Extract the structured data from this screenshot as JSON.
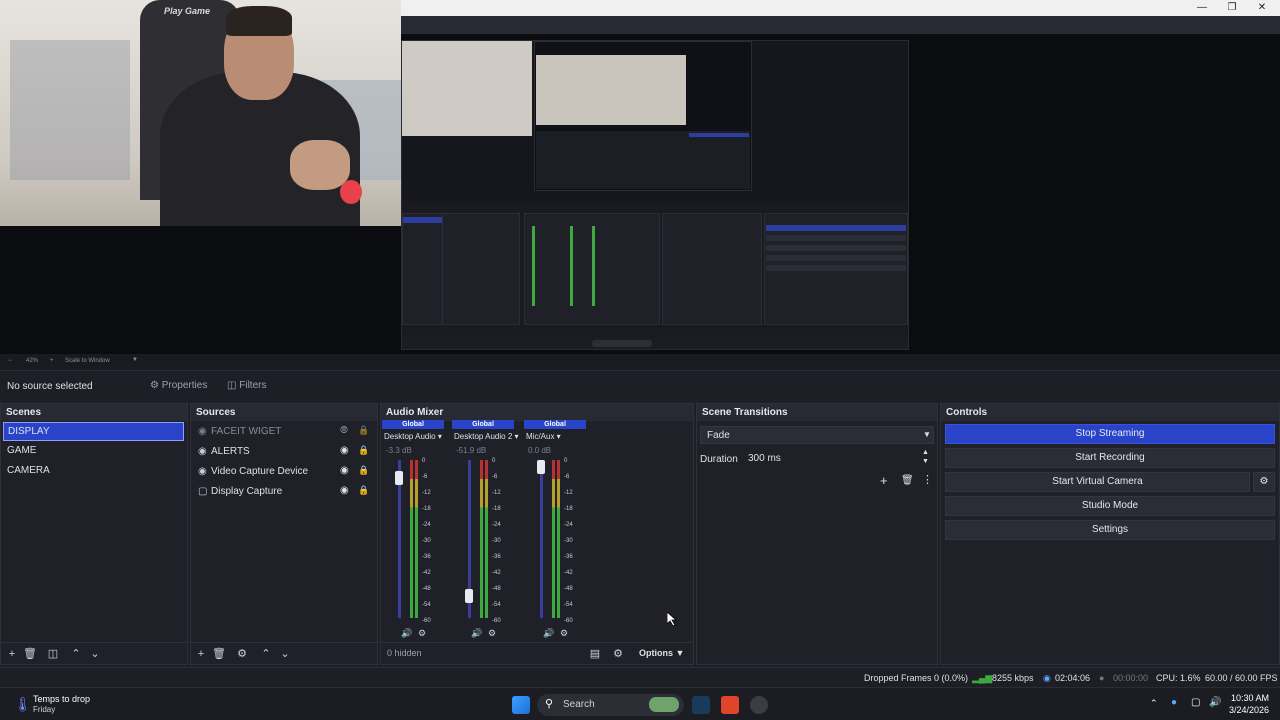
{
  "preview": {
    "webcam_logo": "Play Game",
    "zoom_minus": "−",
    "zoom_level": "42%",
    "zoom_plus": "+",
    "scale_mode": "Scale to Window"
  },
  "source_toolbar": {
    "no_source": "No source selected",
    "properties_label": "Properties",
    "filters_label": "Filters"
  },
  "scenes": {
    "title": "Scenes",
    "items": [
      "DISPLAY",
      "GAME",
      "CAMERA"
    ]
  },
  "sources": {
    "title": "Sources",
    "items": [
      {
        "label": "FACEIT WIGET",
        "icon": "browser-icon",
        "visible": false
      },
      {
        "label": "ALERTS",
        "icon": "browser-icon",
        "visible": true
      },
      {
        "label": "Video Capture Device",
        "icon": "camera-icon",
        "visible": true
      },
      {
        "label": "Display Capture",
        "icon": "monitor-icon",
        "visible": true
      }
    ]
  },
  "audio_mixer": {
    "title": "Audio Mixer",
    "hidden_label": "0 hidden",
    "options_label": "Options",
    "ticks": [
      "0",
      "-6",
      "-12",
      "-18",
      "-24",
      "-30",
      "-36",
      "-42",
      "-48",
      "-54",
      "-60"
    ],
    "channels": [
      {
        "header": "Global",
        "name": "Desktop Audio",
        "db": "-3.3 dB",
        "level": 0.93
      },
      {
        "header": "Global",
        "name": "Desktop Audio 2",
        "db": "-51.9 dB",
        "level": 0.14
      },
      {
        "header": "Global",
        "name": "Mic/Aux",
        "db": "0.0 dB",
        "level": 1.0
      }
    ]
  },
  "scene_transitions": {
    "title": "Scene Transitions",
    "transition": "Fade",
    "duration_label": "Duration",
    "duration_value": "300 ms"
  },
  "controls": {
    "title": "Controls",
    "stop_streaming": "Stop Streaming",
    "start_recording": "Start Recording",
    "start_virtual_camera": "Start Virtual Camera",
    "studio_mode": "Studio Mode",
    "settings": "Settings"
  },
  "status": {
    "dropped_frames": "Dropped Frames 0 (0.0%)",
    "bitrate": "8255 kbps",
    "stream_time": "02:04:06",
    "record_time": "00:00:00",
    "cpu": "CPU: 1.6%",
    "fps": "60.00 / 60.00 FPS"
  },
  "taskbar": {
    "weather_title": "Temps to drop",
    "weather_sub": "Friday",
    "search_placeholder": "Search",
    "time": "10:30 AM",
    "date": "3/24/2026"
  },
  "colors": {
    "accent": "#2a44c9",
    "meter_green": "#3fa83f",
    "meter_yellow": "#b7a02a",
    "meter_red": "#b83232"
  }
}
